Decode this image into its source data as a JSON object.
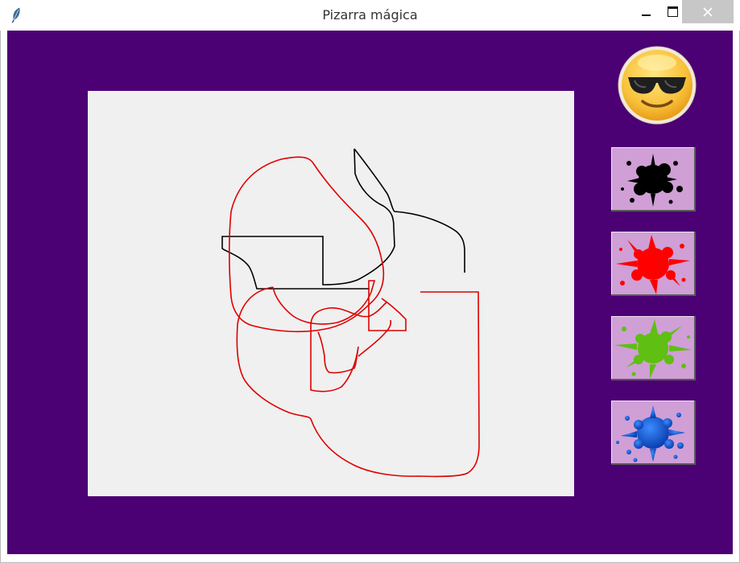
{
  "window": {
    "title": "Pizarra mágica",
    "icon": "feather-icon",
    "controls": [
      "minimize-icon",
      "maximize-icon",
      "close-icon"
    ]
  },
  "colors": {
    "background": "#4b0073",
    "canvas": "#f0f0f0",
    "button_face": "#cf9fd6"
  },
  "smiley": {
    "icon": "sunglasses-smiley-icon"
  },
  "palette": [
    {
      "name": "black",
      "color": "#000000",
      "icon": "paint-splat-icon"
    },
    {
      "name": "red",
      "color": "#ff0000",
      "icon": "paint-splat-icon"
    },
    {
      "name": "green",
      "color": "#5fbf12",
      "icon": "paint-splat-icon"
    },
    {
      "name": "blue",
      "color": "#1a5fdc",
      "icon": "paint-splat-icon"
    }
  ],
  "drawing": {
    "stroke_colors": [
      "#000000",
      "#e00000"
    ]
  }
}
